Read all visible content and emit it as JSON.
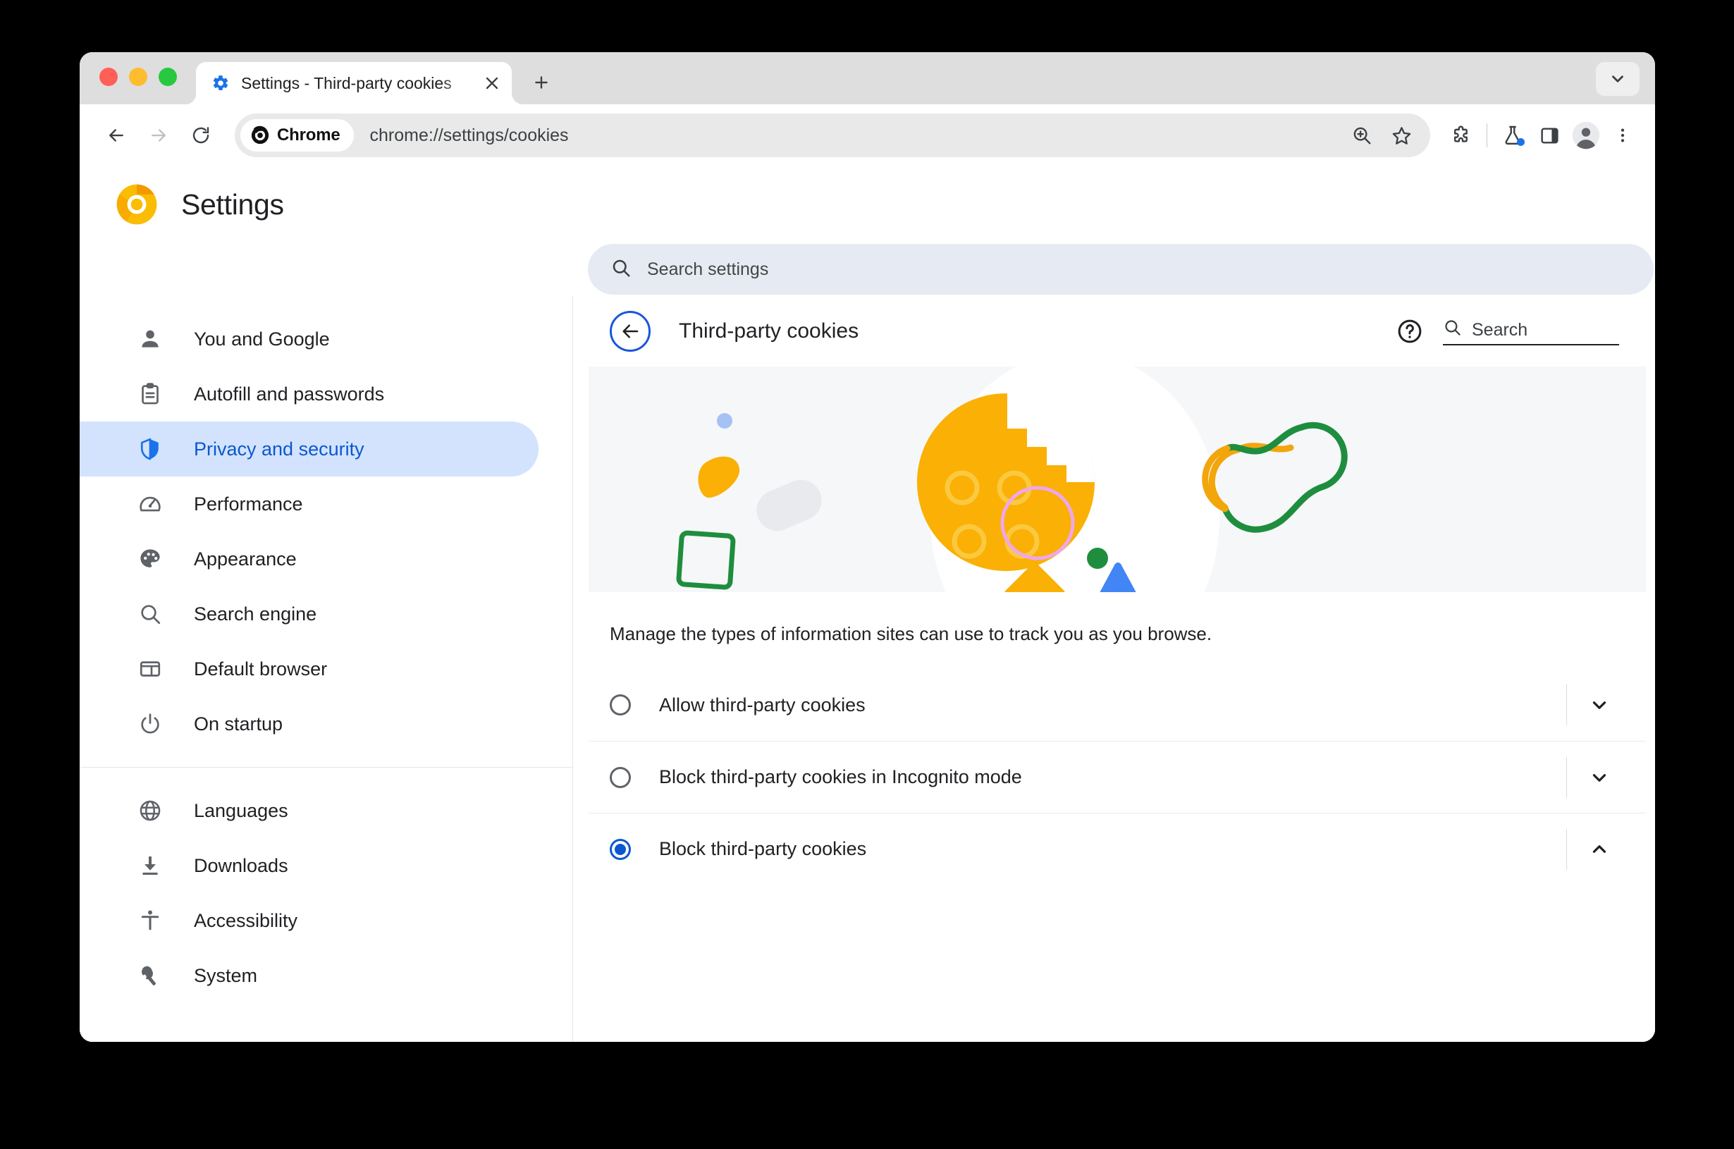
{
  "window": {
    "traffic_lights": [
      "close",
      "minimize",
      "maximize"
    ]
  },
  "tab": {
    "favicon": "gear-icon",
    "title": "Settings - Third-party cookies",
    "close_label": "×",
    "new_tab_label": "+",
    "tab_list_chevron": "chevron-down-icon"
  },
  "toolbar": {
    "back_icon": "arrow-left-icon",
    "forward_icon": "arrow-right-icon",
    "reload_icon": "reload-icon",
    "chrome_pill_label": "Chrome",
    "url": "chrome://settings/cookies",
    "zoom_icon": "zoom-in-icon",
    "bookmark_icon": "star-icon",
    "extensions_icon": "puzzle-icon",
    "experiments_icon": "flask-icon",
    "side_panel_icon": "side-panel-icon",
    "profile_icon": "avatar-icon",
    "menu_icon": "three-dot-menu-icon"
  },
  "settings": {
    "logo": "chrome-logo-icon",
    "title": "Settings",
    "search": {
      "icon": "search-icon",
      "placeholder": "Search settings",
      "value": ""
    }
  },
  "sidebar": {
    "groups": [
      {
        "items": [
          {
            "label": "You and Google",
            "icon": "person-icon",
            "selected": false
          },
          {
            "label": "Autofill and passwords",
            "icon": "clipboard-icon",
            "selected": false
          },
          {
            "label": "Privacy and security",
            "icon": "shield-icon",
            "selected": true
          },
          {
            "label": "Performance",
            "icon": "speedometer-icon",
            "selected": false
          },
          {
            "label": "Appearance",
            "icon": "palette-icon",
            "selected": false
          },
          {
            "label": "Search engine",
            "icon": "magnifier-icon",
            "selected": false
          },
          {
            "label": "Default browser",
            "icon": "browser-window-icon",
            "selected": false
          },
          {
            "label": "On startup",
            "icon": "power-icon",
            "selected": false
          }
        ]
      },
      {
        "items": [
          {
            "label": "Languages",
            "icon": "globe-icon",
            "selected": false
          },
          {
            "label": "Downloads",
            "icon": "download-icon",
            "selected": false
          },
          {
            "label": "Accessibility",
            "icon": "accessibility-icon",
            "selected": false
          },
          {
            "label": "System",
            "icon": "wrench-icon",
            "selected": false
          }
        ]
      }
    ]
  },
  "content": {
    "back_icon": "arrow-left-icon",
    "title": "Third-party cookies",
    "help_icon": "help-circle-icon",
    "search": {
      "icon": "search-icon",
      "placeholder": "Search",
      "value": ""
    },
    "hero": {
      "alt": "cookie-illustration",
      "background": "#f5f7f9",
      "cookie_color": "#fab005",
      "blob_color": "#ffffff",
      "accents": {
        "blue_dot": "#a5c2f5",
        "yellow_wedge": "#fab005",
        "grey_pill": "#e8eaed",
        "green_square_outline": "#1e8e3e",
        "pink_circle_outline": "#f0a6e8",
        "green_dot": "#1e8e3e",
        "yellow_diamond": "#fab005",
        "blue_triangle": "#4285f4",
        "amoeba_green": "#1e8e3e",
        "amoeba_yellow": "#f2a60c"
      }
    },
    "description": "Manage the types of information sites can use to track you as you browse.",
    "options": [
      {
        "label": "Allow third-party cookies",
        "selected": false,
        "chevron": "chevron-down-icon"
      },
      {
        "label": "Block third-party cookies in Incognito mode",
        "selected": false,
        "chevron": "chevron-down-icon"
      },
      {
        "label": "Block third-party cookies",
        "selected": true,
        "chevron": "chevron-up-icon"
      }
    ]
  },
  "colors": {
    "accent_blue": "#0b57d0",
    "selected_bg": "#d3e3fd",
    "chrome_yellow": "#fab005"
  }
}
